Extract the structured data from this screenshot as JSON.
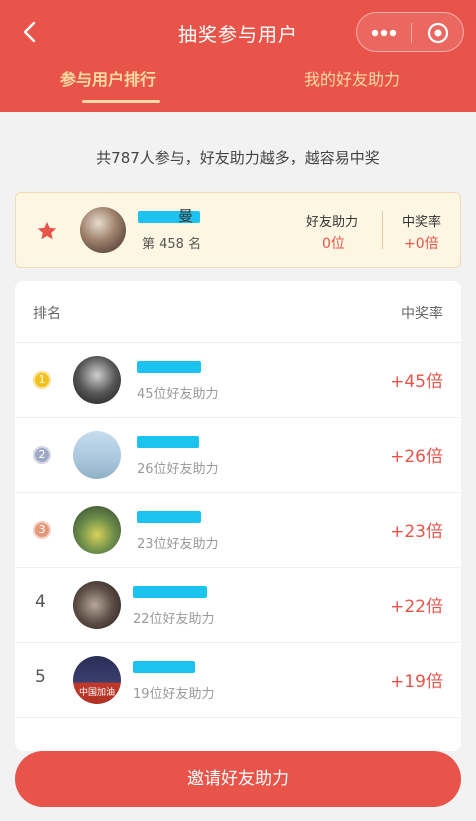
{
  "header": {
    "title": "抽奖参与用户",
    "tabs": [
      "参与用户排行",
      "我的好友助力"
    ]
  },
  "summary": "共787人参与，好友助力越多，越容易中奖",
  "my_card": {
    "name_visible": "曼",
    "rank": "第 458 名",
    "help_label": "好友助力",
    "help_value": "0位",
    "rate_label": "中奖率",
    "rate_value": "+0倍"
  },
  "list": {
    "col_rank": "排名",
    "col_rate": "中奖率",
    "rows": [
      {
        "rank": "1",
        "helpers": "45位好友助力",
        "rate": "+45倍"
      },
      {
        "rank": "2",
        "helpers": "26位好友助力",
        "rate": "+26倍"
      },
      {
        "rank": "3",
        "helpers": "23位好友助力",
        "rate": "+23倍"
      },
      {
        "rank": "4",
        "helpers": "22位好友助力",
        "rate": "+22倍"
      },
      {
        "rank": "5",
        "helpers": "19位好友助力",
        "rate": "+19倍",
        "avatar_text": "中国加油"
      }
    ]
  },
  "invite_button": "邀请好友助力",
  "colors": {
    "brand_red": "#e8544a",
    "tab_gold": "#fdd9a8",
    "name_mask": "#1dc3f0",
    "card_bg": "#fdf6e3"
  }
}
